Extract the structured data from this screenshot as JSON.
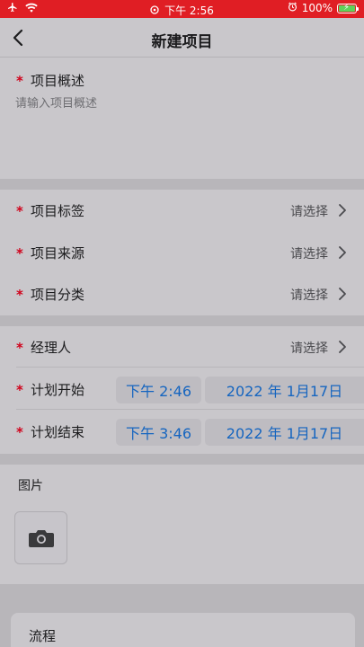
{
  "status_bar": {
    "time": "下午 2:56",
    "battery": "100%"
  },
  "nav": {
    "title": "新建项目"
  },
  "description": {
    "label": "项目概述",
    "placeholder": "请输入项目概述",
    "required_mark": "*"
  },
  "group1": [
    {
      "label": "项目标签",
      "value": "请选择",
      "required_mark": "*"
    },
    {
      "label": "项目来源",
      "value": "请选择",
      "required_mark": "*"
    },
    {
      "label": "项目分类",
      "value": "请选择",
      "required_mark": "*"
    }
  ],
  "manager": {
    "label": "经理人",
    "value": "请选择",
    "required_mark": "*"
  },
  "plan_start": {
    "label": "计划开始",
    "time": "下午 2:46",
    "date": "2022 年 1月17日",
    "required_mark": "*"
  },
  "plan_end": {
    "label": "计划结束",
    "time": "下午 3:46",
    "date": "2022 年 1月17日",
    "required_mark": "*"
  },
  "photos": {
    "label": "图片"
  },
  "process": {
    "label": "流程"
  },
  "colors": {
    "status_bar": "#e01e24",
    "link": "#1565c0",
    "required": "#d0021b",
    "background": "#c9c7cb"
  },
  "icons": {
    "back": "chevron-left-icon",
    "row": "chevron-right-icon",
    "camera": "camera-icon"
  }
}
